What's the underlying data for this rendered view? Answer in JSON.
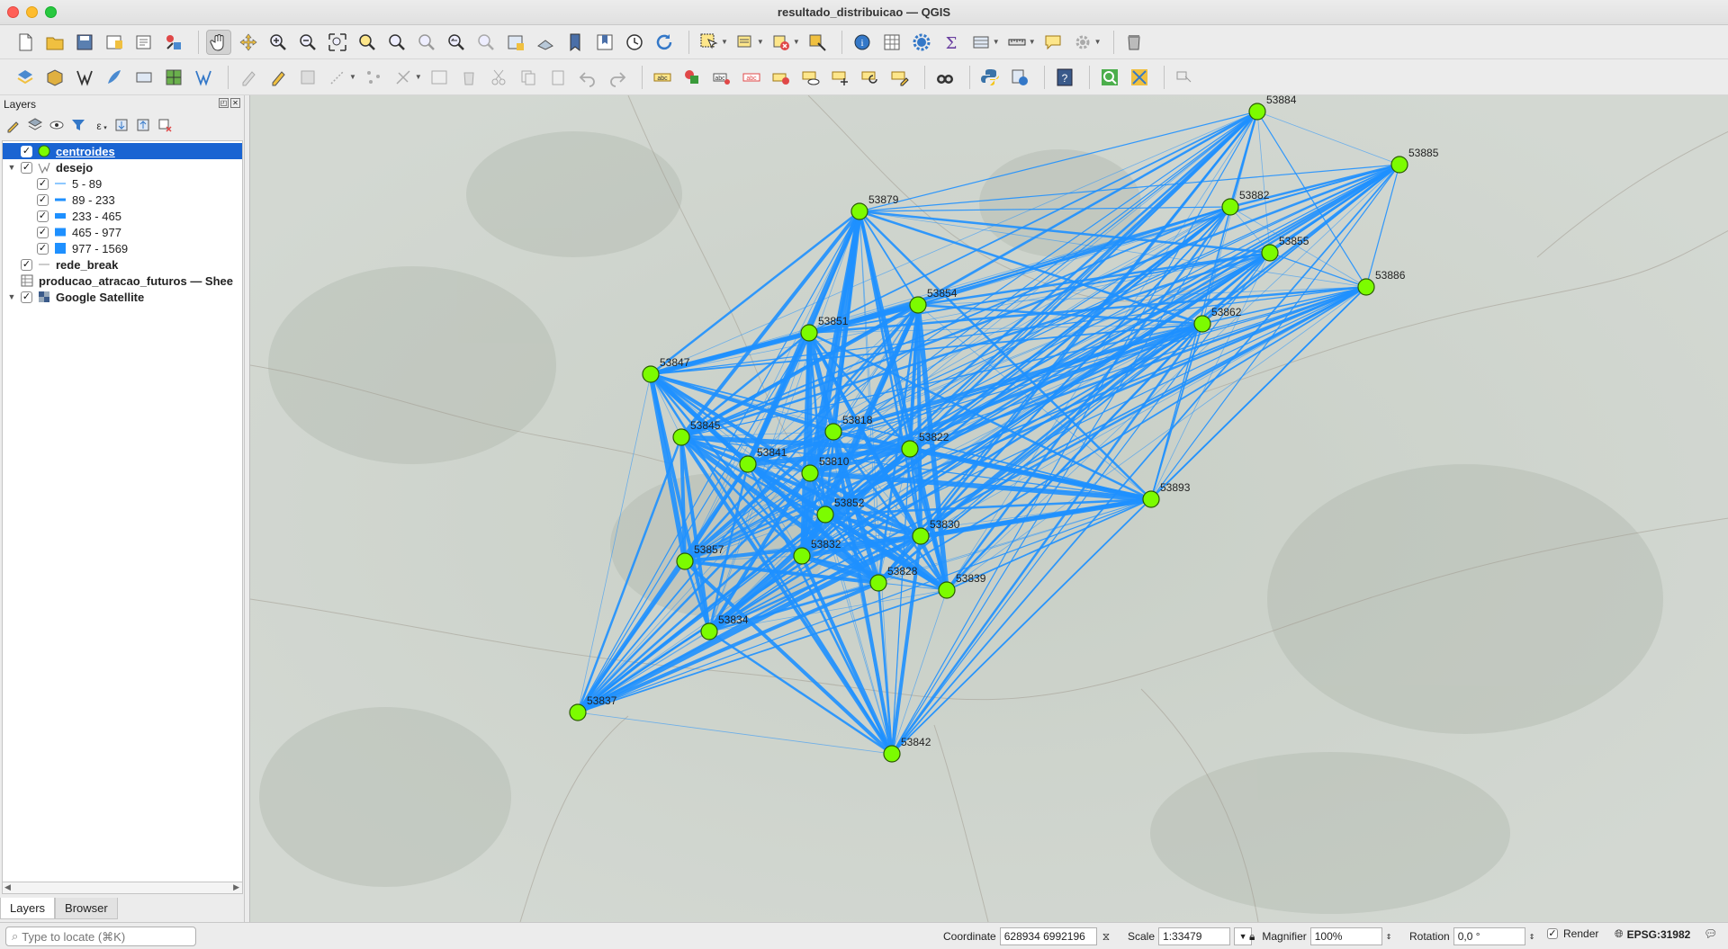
{
  "window": {
    "title": "resultado_distribuicao — QGIS"
  },
  "layers_panel": {
    "title": "Layers",
    "layers": [
      {
        "name": "centroides",
        "checked": true,
        "selected": true
      },
      {
        "name": "desejo",
        "checked": true,
        "expanded": true,
        "classes": [
          {
            "label": "5 - 89",
            "checked": true
          },
          {
            "label": "89 - 233",
            "checked": true
          },
          {
            "label": "233 - 465",
            "checked": true
          },
          {
            "label": "465 - 977",
            "checked": true
          },
          {
            "label": "977 - 1569",
            "checked": true
          }
        ]
      },
      {
        "name": "rede_break",
        "checked": true
      },
      {
        "name": "producao_atracao_futuros — Shee"
      },
      {
        "name": "Google Satellite",
        "checked": true
      }
    ],
    "tabs": [
      "Layers",
      "Browser"
    ]
  },
  "map": {
    "line_color": "#1e90ff",
    "node_color": "#7cfc00",
    "nodes": [
      {
        "id": "53884"
      },
      {
        "id": "53885"
      },
      {
        "id": "53879"
      },
      {
        "id": "53882"
      },
      {
        "id": "53855"
      },
      {
        "id": "53886"
      },
      {
        "id": "53854"
      },
      {
        "id": "53862"
      },
      {
        "id": "53851"
      },
      {
        "id": "53847"
      },
      {
        "id": "53818"
      },
      {
        "id": "53845"
      },
      {
        "id": "53822"
      },
      {
        "id": "53841"
      },
      {
        "id": "53810"
      },
      {
        "id": "53893"
      },
      {
        "id": "53852"
      },
      {
        "id": "53830"
      },
      {
        "id": "53857"
      },
      {
        "id": "53832"
      },
      {
        "id": "53828"
      },
      {
        "id": "53839"
      },
      {
        "id": "53834"
      },
      {
        "id": "53837"
      },
      {
        "id": "53842"
      }
    ]
  },
  "status": {
    "locate_placeholder": "Type to locate (⌘K)",
    "coordinate_label": "Coordinate",
    "coordinate_value": "628934 6992196",
    "scale_label": "Scale",
    "scale_value": "1:33479",
    "magnifier_label": "Magnifier",
    "magnifier_value": "100%",
    "rotation_label": "Rotation",
    "rotation_value": "0,0 °",
    "render_label": "Render",
    "crs": "EPSG:31982"
  }
}
